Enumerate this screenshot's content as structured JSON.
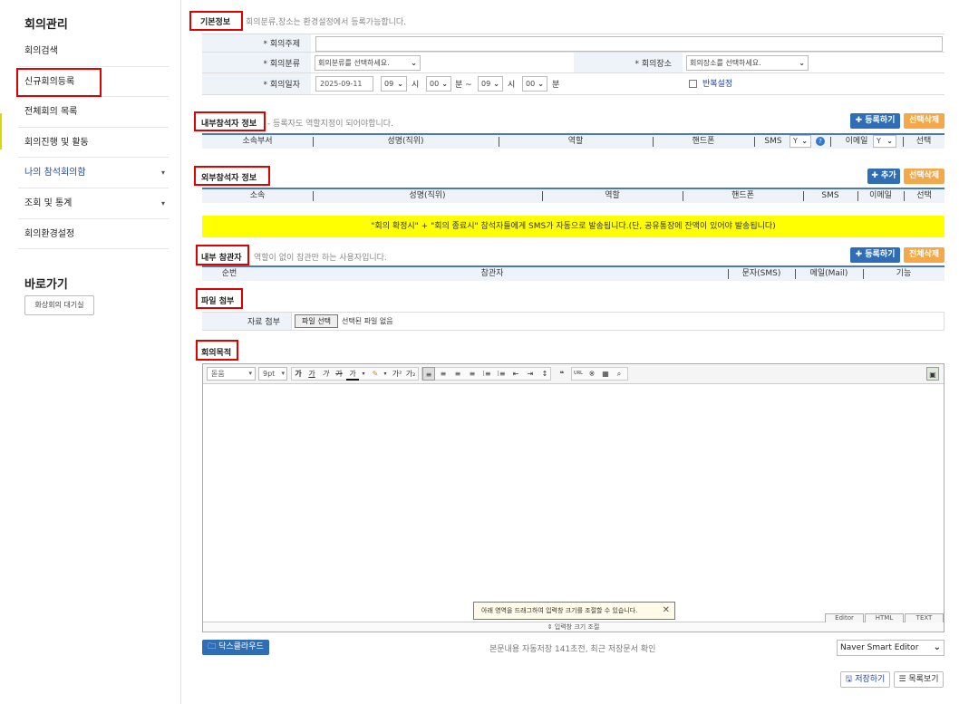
{
  "sidebar": {
    "title": "회의관리",
    "items": [
      {
        "label": "회의검색"
      },
      {
        "label": "신규회의등록"
      },
      {
        "label": "전체회의 목록"
      },
      {
        "label": "회의진행 및 활동"
      },
      {
        "label": "나의 참석회의함",
        "caret": "▾"
      },
      {
        "label": "조회 및 통계",
        "caret": "▾"
      },
      {
        "label": "회의환경설정"
      }
    ],
    "quick_title": "바로가기",
    "quick_button": "화상회의 대기실"
  },
  "basic": {
    "label": "기본정보",
    "note": "회의분류,장소는 환경설정에서 등록가능합니다.",
    "subject_label": "* 회의주제",
    "category_label": "* 회의분류",
    "category_value": "회의분류를 선택하세요.",
    "place_label": "* 회의장소",
    "place_value": "회의장소를 선택하세요.",
    "date_label": "* 회의일자",
    "date_value": "2025-09-11",
    "start_hour": "09",
    "hour_unit": "시",
    "start_min": "00",
    "min_range_unit": "분 ~",
    "end_hour": "09",
    "end_min": "00",
    "min_unit": "분",
    "repeat_label": "반복설정"
  },
  "internal": {
    "label": "내부참석자 정보",
    "note": "- 등록자도 역할지정이 되어야합니다.",
    "add_button": "✚ 등록하기",
    "delete_button": "선택삭제",
    "headers": [
      "소속부서",
      "성명(직위)",
      "역할",
      "핸드폰",
      "SMS",
      "이메일",
      "선택"
    ],
    "sms_value": "Y",
    "email_value": "Y"
  },
  "external": {
    "label": "외부참석자 정보",
    "add_button": "✚ 추가",
    "delete_button": "선택삭제",
    "headers": [
      "소속",
      "성명(직위)",
      "역할",
      "핸드폰",
      "SMS",
      "이메일",
      "선택"
    ]
  },
  "notice": "\"회의 확정시\" + \"회의 종료시\" 참석자들에게 SMS가 자동으로 발송됩니다.(단, 공유통장에 잔액이 있어야 발송됩니다)",
  "observer": {
    "label": "내부 참관자",
    "note": "역할이 없이 참관만 하는 사용자입니다.",
    "add_button": "✚ 등록하기",
    "delete_button": "전체삭제",
    "headers": [
      "순번",
      "참관자",
      "문자(SMS)",
      "메일(Mail)",
      "기능"
    ]
  },
  "attach": {
    "label": "파일 첨부",
    "row_label": "자료 첨부",
    "file_button": "파일 선택",
    "file_status": "선택된 파일 없음"
  },
  "purpose": {
    "label": "회의목적"
  },
  "editor": {
    "font": "돋움",
    "size": "9pt",
    "tooltip": "아래 영역을 드래그하여 입력창 크기를 조절할 수 있습니다.",
    "resize": "⇕ 입력창 크기 조절",
    "tabs": [
      "Editor",
      "HTML",
      "TEXT"
    ]
  },
  "footer": {
    "docs_button": "🗀 닥스클라우드",
    "autosave": "본문내용 자동저장 141초전, 최근 저장문서 확인",
    "editor_select": "Naver Smart Editor",
    "save_button": "🖫 저장하기",
    "list_button": "☰ 목록보기"
  }
}
